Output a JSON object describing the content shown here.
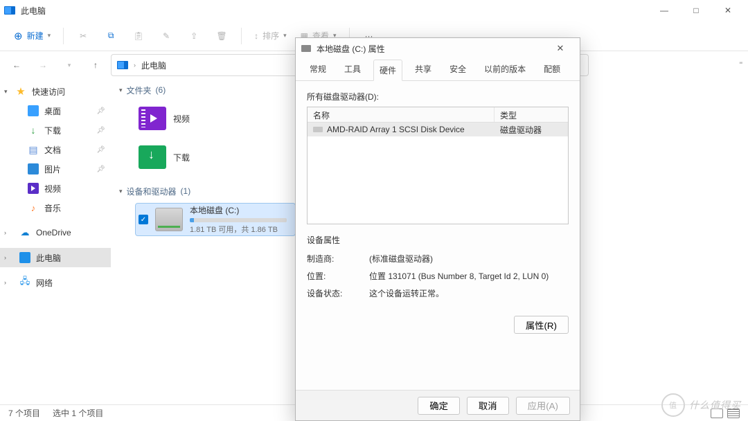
{
  "window": {
    "title": "此电脑"
  },
  "win_controls": {
    "min": "—",
    "max": "□",
    "close": "✕"
  },
  "toolbar": {
    "new": "新建",
    "sort": "排序",
    "view": "查看",
    "more": "···"
  },
  "address": {
    "path": "此电脑",
    "trailing_hint": "\""
  },
  "sidebar": {
    "quick": "快速访问",
    "desktop": "桌面",
    "downloads": "下载",
    "documents": "文档",
    "pictures": "图片",
    "videos": "视频",
    "music": "音乐",
    "onedrive": "OneDrive",
    "thispc": "此电脑",
    "network": "网络"
  },
  "groups": {
    "folders": {
      "label": "文件夹",
      "count": "(6)"
    },
    "devices": {
      "label": "设备和驱动器",
      "count": "(1)"
    }
  },
  "tiles": {
    "videos": "视频",
    "downloads": "下载",
    "drive_c": {
      "name": "本地磁盘 (C:)",
      "sub": "1.81 TB 可用，共 1.86 TB"
    }
  },
  "status": {
    "items": "7 个项目",
    "selected": "选中 1 个项目"
  },
  "dialog": {
    "title": "本地磁盘 (C:) 属性",
    "tabs": {
      "general": "常规",
      "tools": "工具",
      "hardware": "硬件",
      "sharing": "共享",
      "security": "安全",
      "previous": "以前的版本",
      "quota": "配额"
    },
    "all_drives_label": "所有磁盘驱动器(D):",
    "cols": {
      "name": "名称",
      "type": "类型"
    },
    "row": {
      "name": "AMD-RAID Array 1  SCSI Disk Device",
      "type": "磁盘驱动器"
    },
    "props_header": "设备属性",
    "manufacturer_k": "制造商:",
    "manufacturer_v": "(标准磁盘驱动器)",
    "location_k": "位置:",
    "location_v": "位置 131071 (Bus Number 8, Target Id 2, LUN 0)",
    "status_k": "设备状态:",
    "status_v": "这个设备运转正常。",
    "properties_btn": "属性(R)",
    "ok": "确定",
    "cancel": "取消",
    "apply": "应用(A)"
  },
  "watermark": {
    "text": "什么值得买",
    "badge": "值"
  }
}
